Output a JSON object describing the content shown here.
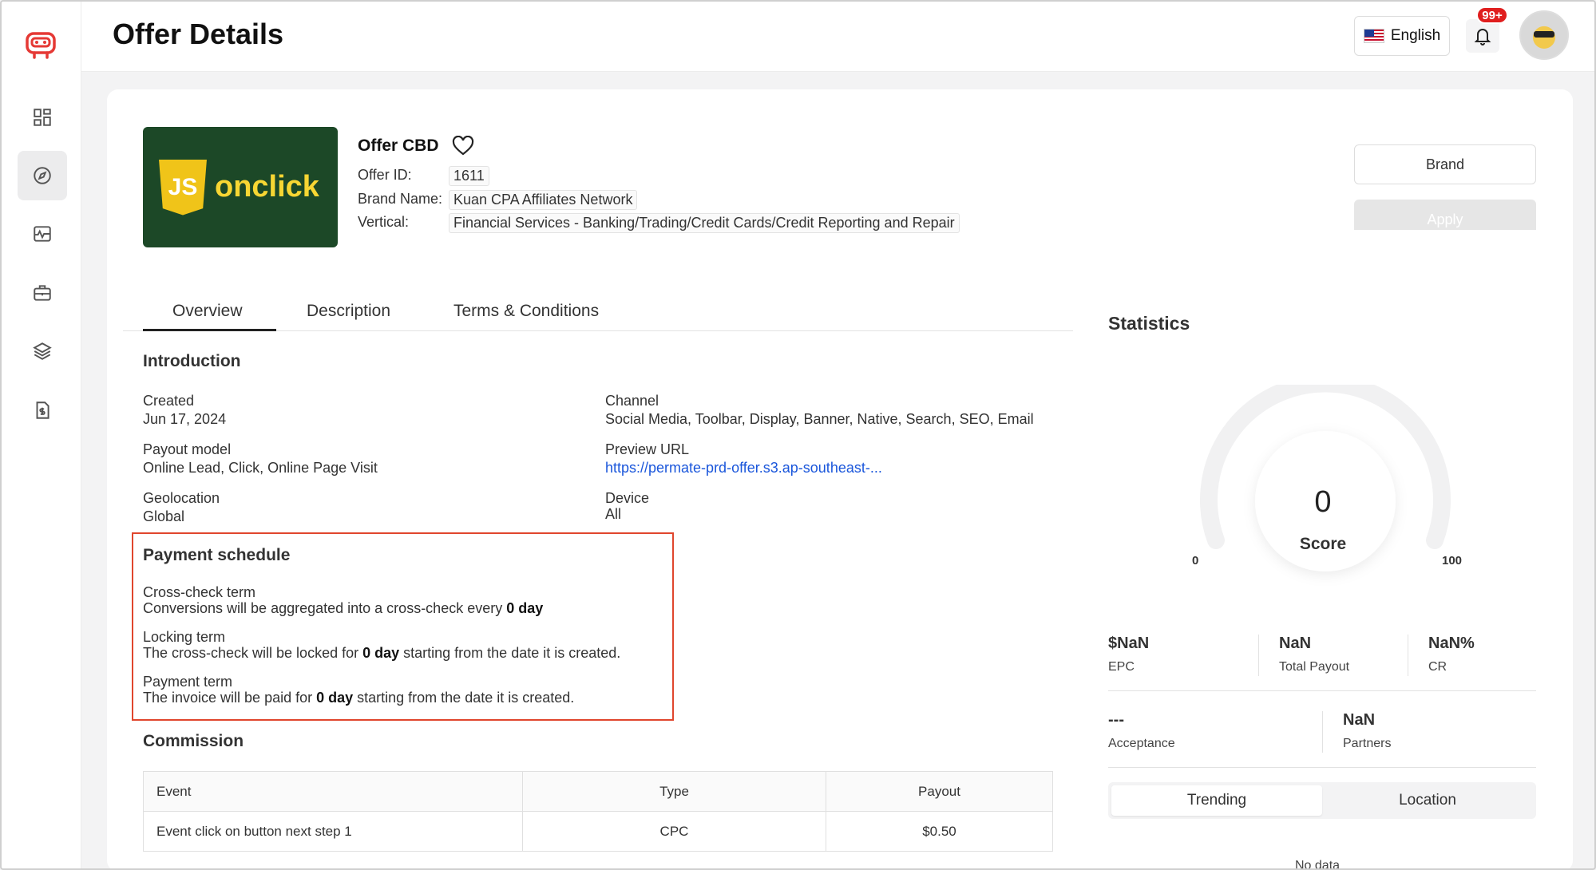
{
  "header": {
    "title": "Offer Details",
    "language": "English",
    "notification_badge": "99+"
  },
  "sidebar": {
    "items": [
      {
        "icon": "dashboard-icon",
        "active": false
      },
      {
        "icon": "compass-icon",
        "active": true
      },
      {
        "icon": "analytics-icon",
        "active": false
      },
      {
        "icon": "briefcase-icon",
        "active": false
      },
      {
        "icon": "layers-icon",
        "active": false
      },
      {
        "icon": "invoice-icon",
        "active": false
      }
    ]
  },
  "offer": {
    "logo_text": "onclick",
    "logo_badge": "JS",
    "name": "Offer CBD",
    "id_label": "Offer ID:",
    "id_value": "1611",
    "brand_label": "Brand Name:",
    "brand_value": "Kuan CPA Affiliates Network",
    "vertical_label": "Vertical:",
    "vertical_value": "Financial Services - Banking/Trading/Credit Cards/Credit Reporting and Repair"
  },
  "actions": {
    "brand": "Brand",
    "apply": "Apply"
  },
  "tabs": [
    {
      "label": "Overview",
      "active": true
    },
    {
      "label": "Description",
      "active": false
    },
    {
      "label": "Terms & Conditions",
      "active": false
    }
  ],
  "introduction": {
    "title": "Introduction",
    "created_label": "Created",
    "created_value": "Jun 17, 2024",
    "payout_label": "Payout model",
    "payout_value": "Online Lead, Click, Online Page Visit",
    "geo_label": "Geolocation",
    "geo_value": "Global",
    "channel_label": "Channel",
    "channel_value": "Social Media, Toolbar, Display, Banner, Native, Search, SEO, Email",
    "preview_label": "Preview URL",
    "preview_value": "https://permate-prd-offer.s3.ap-southeast-...",
    "device_label": "Device",
    "device_value": "All"
  },
  "payment_schedule": {
    "title": "Payment schedule",
    "cross_label": "Cross-check term",
    "cross_pre": "Conversions will be aggregated into a cross-check every ",
    "cross_bold": "0 day",
    "lock_label": "Locking term",
    "lock_pre": "The cross-check will be locked for ",
    "lock_bold": "0 day",
    "lock_post": " starting from the date it is created.",
    "pay_label": "Payment term",
    "pay_pre": "The invoice will be paid for ",
    "pay_bold": "0 day",
    "pay_post": " starting from the date it is created."
  },
  "commission": {
    "title": "Commission",
    "headers": [
      "Event",
      "Type",
      "Payout"
    ],
    "rows": [
      [
        "Event click on button next step 1",
        "CPC",
        "$0.50"
      ]
    ]
  },
  "statistics": {
    "title": "Statistics",
    "score": "0",
    "score_label": "Score",
    "gauge_min": "0",
    "gauge_max": "100",
    "epc_value": "$NaN",
    "epc_label": "EPC",
    "total_payout_value": "NaN",
    "total_payout_label": "Total Payout",
    "cr_value": "NaN%",
    "cr_label": "CR",
    "acceptance_value": "---",
    "acceptance_label": "Acceptance",
    "partners_value": "NaN",
    "partners_label": "Partners",
    "seg_trending": "Trending",
    "seg_location": "Location",
    "no_data": "No data"
  },
  "colors": {
    "accent_red": "#e0462d",
    "link": "#1a56db",
    "logo_bg": "#1c4827",
    "logo_text": "#f7d633"
  }
}
